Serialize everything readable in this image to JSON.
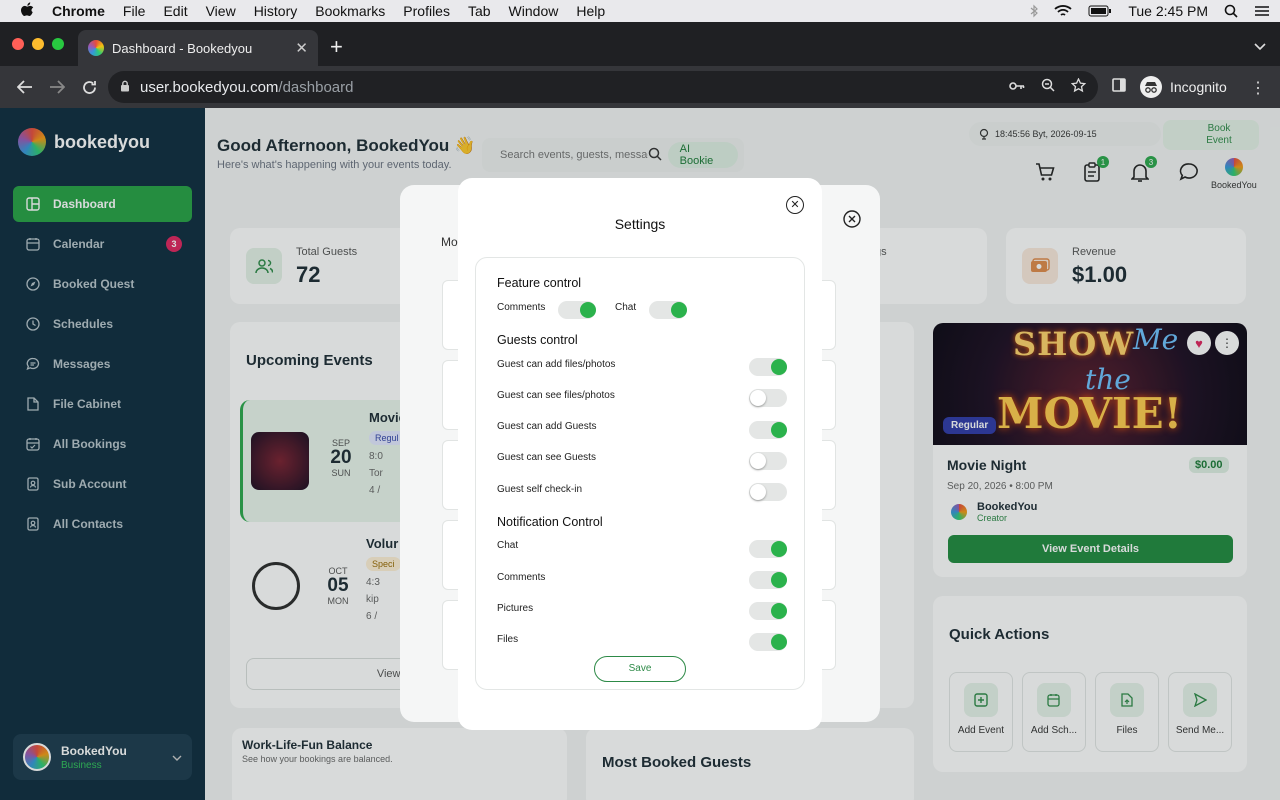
{
  "menubar": {
    "app": "Chrome",
    "menus": [
      "File",
      "Edit",
      "View",
      "History",
      "Bookmarks",
      "Profiles",
      "Tab",
      "Window",
      "Help"
    ],
    "clock": "Tue 2:45 PM"
  },
  "browser": {
    "tab_title": "Dashboard - Bookedyou",
    "url_host": "user.bookedyou.com",
    "url_path": "/dashboard",
    "profile_label": "Incognito"
  },
  "sidebar": {
    "brand": "bookedyou",
    "items": [
      {
        "label": "Dashboard",
        "active": true
      },
      {
        "label": "Calendar",
        "badge": "3"
      },
      {
        "label": "Booked Quest"
      },
      {
        "label": "Schedules"
      },
      {
        "label": "Messages"
      },
      {
        "label": "File Cabinet"
      },
      {
        "label": "All Bookings"
      },
      {
        "label": "Sub Account"
      },
      {
        "label": "All Contacts"
      }
    ],
    "account": {
      "name": "BookedYou",
      "type": "Business"
    }
  },
  "header": {
    "greeting": "Good Afternoon, BookedYou 👋",
    "subtitle": "Here's what's happening with your events today.",
    "search_placeholder": "Search events, guests, messages...",
    "ai_button": "AI Bookie",
    "clock_text": "18:45:56 Byt,  2026-09-15",
    "book_event": "Book Event",
    "clipboard_badge": "1",
    "bell_badge": "3",
    "profile_label": "BookedYou"
  },
  "stats": {
    "total_guests_label": "Total Guests",
    "total_guests_value": "72",
    "hidden_label_fragment": "gs",
    "revenue_label": "Revenue",
    "revenue_value": "$1.00"
  },
  "upcoming": {
    "title": "Upcoming Events",
    "events": [
      {
        "month": "SEP",
        "day": "20",
        "weekday": "SUN",
        "title": "Movie",
        "tag": "Regul",
        "time": "8:0",
        "place": "Tor",
        "guests": "4 /"
      },
      {
        "month": "OCT",
        "day": "05",
        "weekday": "MON",
        "title": "Volur",
        "tag": "Speci",
        "time": "4:3",
        "place": "kip",
        "guests": "6 /"
      }
    ],
    "view_all": "View All"
  },
  "featured": {
    "image_text": [
      "SHOW",
      "Me",
      "the",
      "MOVIE!"
    ],
    "tag": "Regular",
    "title": "Movie Night",
    "price": "$0.00",
    "datetime": "Sep 20, 2026 • 8:00 PM",
    "creator_name": "BookedYou",
    "creator_role": "Creator",
    "button": "View Event Details"
  },
  "quick_actions": {
    "title": "Quick Actions",
    "items": [
      "Add Event",
      "Add Sch...",
      "Files",
      "Send Me..."
    ]
  },
  "wlf": {
    "title": "Work-Life-Fun Balance",
    "subtitle": "See how your bookings are balanced."
  },
  "most_booked": {
    "title": "Most Booked Guests"
  },
  "back_dialog": {
    "label_fragment": "Mo"
  },
  "settings": {
    "title": "Settings",
    "feature_title": "Feature control",
    "feature": [
      {
        "label": "Comments",
        "on": true
      },
      {
        "label": "Chat",
        "on": true
      }
    ],
    "guests_title": "Guests control",
    "guests": [
      {
        "label": "Guest can add files/photos",
        "on": true
      },
      {
        "label": "Guest can see files/photos",
        "on": false
      },
      {
        "label": "Guest can add Guests",
        "on": true
      },
      {
        "label": "Guest can see Guests",
        "on": false
      },
      {
        "label": "Guest self check-in",
        "on": false
      }
    ],
    "notif_title": "Notification Control",
    "notifications": [
      {
        "label": "Chat",
        "on": true
      },
      {
        "label": "Comments",
        "on": true
      },
      {
        "label": "Pictures",
        "on": true
      },
      {
        "label": "Files",
        "on": true
      }
    ],
    "save": "Save"
  },
  "colors": {
    "accent": "#25a244",
    "sidebar": "#0d2b3e",
    "toggle_on": "#2bb24c"
  }
}
